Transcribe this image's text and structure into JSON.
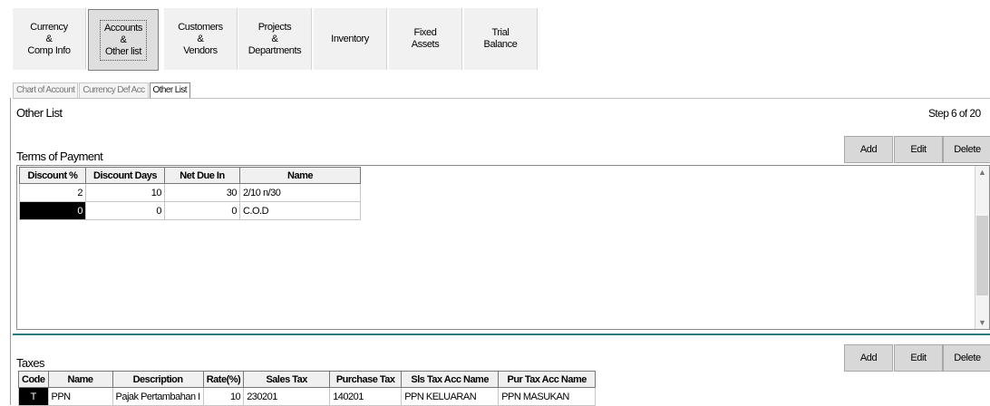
{
  "nav": [
    {
      "lines": [
        "Currency",
        "&",
        "Comp Info"
      ],
      "active": false
    },
    {
      "lines": [
        "Accounts",
        "&",
        "Other list"
      ],
      "active": true
    },
    {
      "lines": [
        "Customers",
        "&",
        "Vendors"
      ],
      "active": false
    },
    {
      "lines": [
        "Projects",
        "&",
        "Departments"
      ],
      "active": false
    },
    {
      "lines": [
        "Inventory"
      ],
      "active": false
    },
    {
      "lines": [
        "Fixed",
        "Assets"
      ],
      "active": false
    },
    {
      "lines": [
        "Trial",
        "Balance"
      ],
      "active": false
    }
  ],
  "subtabs": [
    "Chart of Account",
    "Currency Def Acc",
    "Other List"
  ],
  "page": {
    "title": "Other List",
    "step": "Step 6 of 20"
  },
  "terms": {
    "title": "Terms of Payment",
    "buttons": {
      "add": "Add",
      "edit": "Edit",
      "delete": "Delete"
    },
    "columns": [
      "Discount %",
      "Discount Days",
      "Net Due In",
      "Name"
    ],
    "rows": [
      {
        "discount": "2",
        "days": "10",
        "net": "30",
        "name": "2/10 n/30"
      },
      {
        "discount": "0",
        "days": "0",
        "net": "0",
        "name": "C.O.D"
      }
    ]
  },
  "taxes": {
    "title": "Taxes",
    "buttons": {
      "add": "Add",
      "edit": "Edit",
      "delete": "Delete"
    },
    "columns": [
      "Code",
      "Name",
      "Description",
      "Rate(%)",
      "Sales Tax",
      "Purchase Tax",
      "Sls Tax Acc Name",
      "Pur Tax Acc Name"
    ],
    "rows": [
      {
        "code": "T",
        "name": "PPN",
        "description": "Pajak Pertambahan I",
        "rate": "10",
        "sales": "230201",
        "purchase": "140201",
        "sls_name": "PPN KELUARAN",
        "pur_name": "PPN MASUKAN"
      }
    ]
  },
  "colors": {
    "accent_line": "#2a7c7c",
    "selection": "#000000"
  }
}
